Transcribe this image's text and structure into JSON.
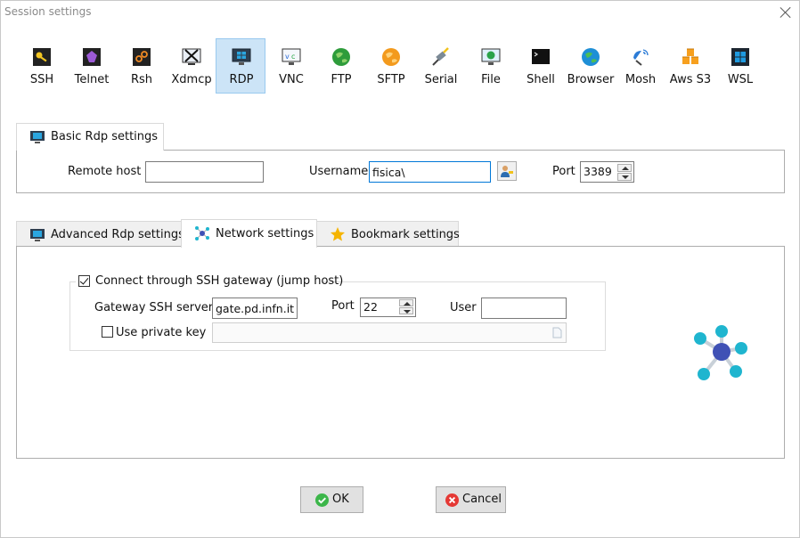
{
  "window": {
    "title": "Session settings"
  },
  "session_types": [
    {
      "label": "SSH",
      "icon": "ssh-key-icon"
    },
    {
      "label": "Telnet",
      "icon": "telnet-icon"
    },
    {
      "label": "Rsh",
      "icon": "rsh-icon"
    },
    {
      "label": "Xdmcp",
      "icon": "xdmcp-icon"
    },
    {
      "label": "RDP",
      "icon": "rdp-monitor-icon",
      "selected": true
    },
    {
      "label": "VNC",
      "icon": "vnc-icon"
    },
    {
      "label": "FTP",
      "icon": "ftp-globe-icon"
    },
    {
      "label": "SFTP",
      "icon": "sftp-globe-icon"
    },
    {
      "label": "Serial",
      "icon": "serial-plug-icon"
    },
    {
      "label": "File",
      "icon": "file-icon"
    },
    {
      "label": "Shell",
      "icon": "shell-terminal-icon"
    },
    {
      "label": "Browser",
      "icon": "browser-globe-icon"
    },
    {
      "label": "Mosh",
      "icon": "mosh-satellite-icon"
    },
    {
      "label": "Aws S3",
      "icon": "aws-s3-icon"
    },
    {
      "label": "WSL",
      "icon": "wsl-windows-icon"
    }
  ],
  "basic": {
    "tab_label": "Basic Rdp settings",
    "remote_host_label": "Remote host *",
    "remote_host_value": "",
    "username_label": "Username",
    "username_value": "fisica\\",
    "port_label": "Port",
    "port_value": "3389"
  },
  "tabs": {
    "advanced": "Advanced Rdp settings",
    "network": "Network settings",
    "bookmark": "Bookmark settings",
    "active": "network"
  },
  "network": {
    "ssh_gateway_checkbox": "Connect through SSH gateway (jump host)",
    "ssh_gateway_checked": true,
    "gateway_server_label": "Gateway SSH server",
    "gateway_server_value": "gate.pd.infn.it",
    "port_label": "Port",
    "port_value": "22",
    "user_label": "User",
    "user_value": "",
    "private_key_label": "Use private key",
    "private_key_checked": false,
    "private_key_value": ""
  },
  "buttons": {
    "ok": "OK",
    "cancel": "Cancel"
  },
  "colors": {
    "selected_bg": "#cce4f7",
    "network_node": "#1fb5cf",
    "network_center": "#3f51b5",
    "ok_green": "#3cb64a",
    "cancel_red": "#e53935"
  }
}
